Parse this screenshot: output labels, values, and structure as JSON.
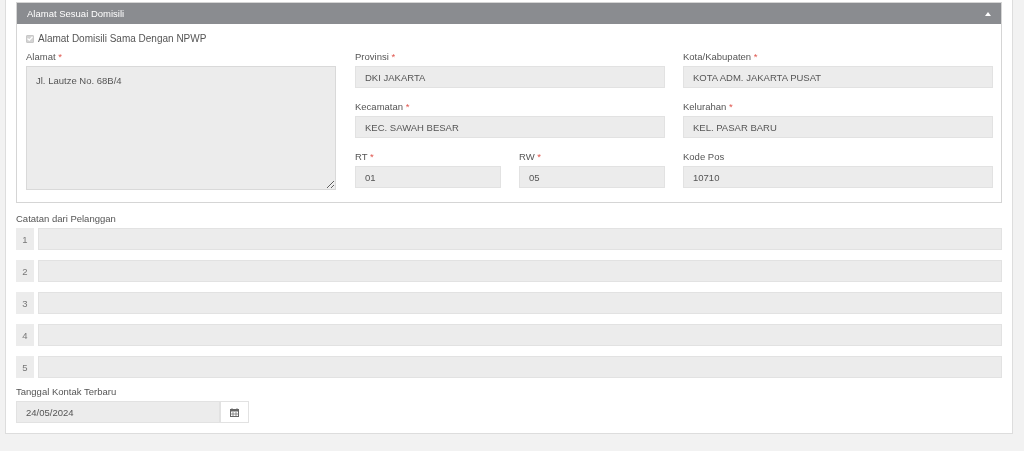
{
  "panel": {
    "title": "Alamat Sesuai Domisili",
    "expanded": true,
    "same_as_npwp": {
      "label": "Alamat Domisili Sama Dengan NPWP",
      "checked": true,
      "disabled": true
    },
    "address": {
      "label": "Alamat",
      "required_mark": "*",
      "value": "Jl. Lautze No. 68B/4"
    },
    "field_rows": [
      [
        {
          "label": "Provinsi",
          "required_mark": "*",
          "value": "DKI JAKARTA"
        },
        {
          "label": "Kota/Kabupaten",
          "required_mark": "*",
          "value": "KOTA ADM. JAKARTA PUSAT"
        }
      ],
      [
        {
          "label": "Kecamatan",
          "required_mark": "*",
          "value": "KEC. SAWAH BESAR"
        },
        {
          "label": "Kelurahan",
          "required_mark": "*",
          "value": "KEL. PASAR BARU"
        }
      ],
      [
        {
          "label": "RT",
          "required_mark": "*",
          "value": "01"
        },
        {
          "label": "RW",
          "required_mark": "*",
          "value": "05"
        },
        {
          "label": "Kode Pos",
          "value": "10710"
        }
      ]
    ]
  },
  "notes": {
    "label": "Catatan dari Pelanggan",
    "rows": [
      {
        "number": "1"
      },
      {
        "number": "2"
      },
      {
        "number": "3"
      },
      {
        "number": "4"
      },
      {
        "number": "5"
      }
    ]
  },
  "last_contact": {
    "label": "Tanggal Kontak Terbaru",
    "value": "24/05/2024"
  }
}
